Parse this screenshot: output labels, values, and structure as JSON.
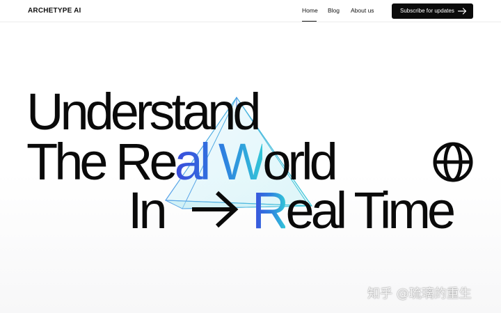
{
  "header": {
    "logo": "ARCHETYPE AI",
    "nav": {
      "home": "Home",
      "blog": "Blog",
      "about": "About us"
    },
    "cta_label": "Subscribe for updates",
    "cta_icon": "arrow-right-icon"
  },
  "hero": {
    "line1": "Understand",
    "line2_prefix": "The Re",
    "line2_accent": "al W",
    "line2_suffix": "orld",
    "line3_start": "In",
    "line3_end_accent": "R",
    "line3_end": "eal Time",
    "icons": [
      "prism-triangle-icon",
      "globe-icon",
      "arrow-right-icon"
    ]
  },
  "watermark": "知乎 @琉璃的重生",
  "colors": {
    "text": "#0a0a0a",
    "button_bg": "#0b0b0b",
    "accent_start": "#3b4bdb",
    "accent_end": "#33c6d8"
  }
}
